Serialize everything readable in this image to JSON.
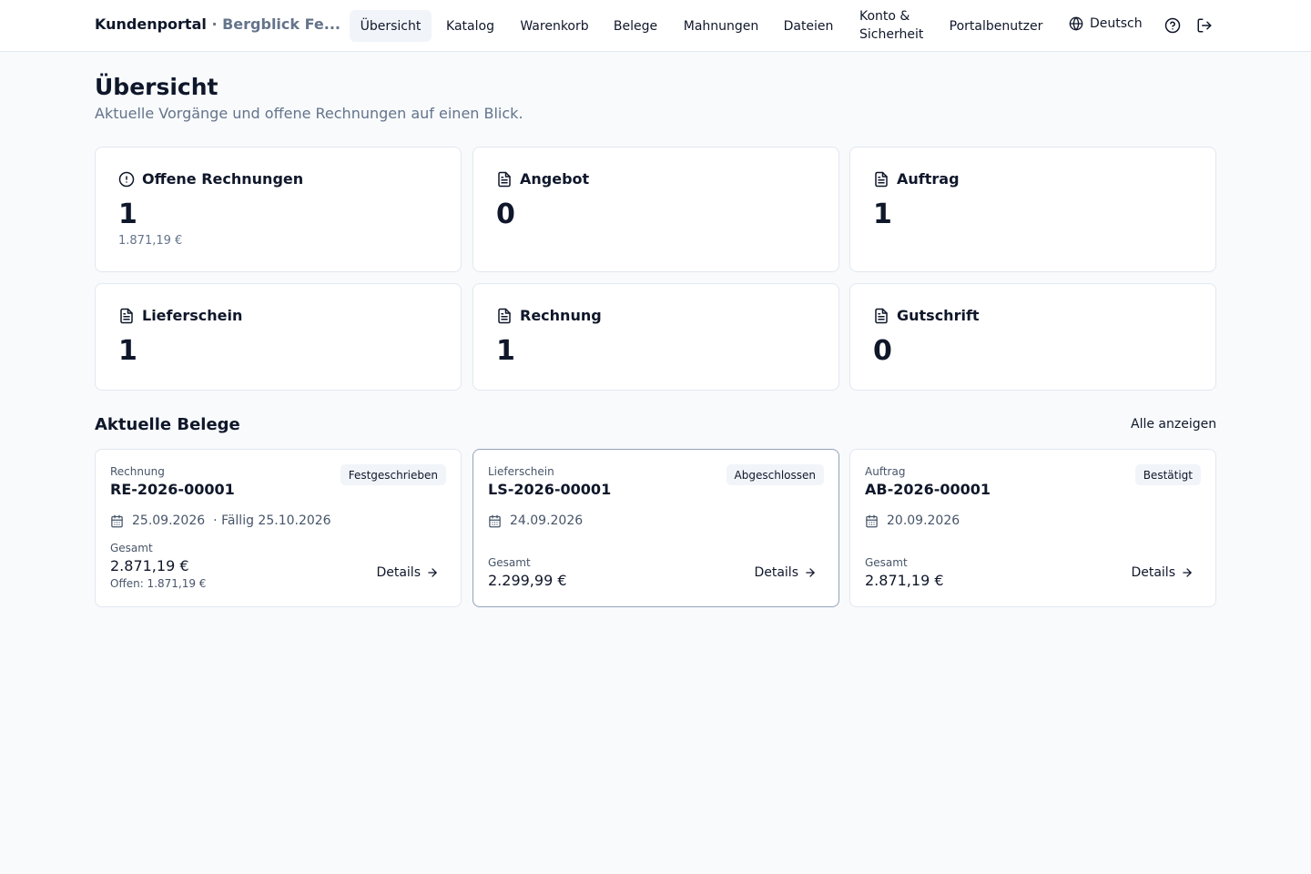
{
  "header": {
    "brand": "Kundenportal",
    "separator": "·",
    "company": "Bergblick Fe...",
    "nav": [
      {
        "label": "Übersicht"
      },
      {
        "label": "Katalog"
      },
      {
        "label": "Warenkorb"
      },
      {
        "label": "Belege"
      },
      {
        "label": "Mahnungen"
      },
      {
        "label": "Dateien"
      },
      {
        "label": "Konto & Sicherheit"
      },
      {
        "label": "Portalbenutzer"
      }
    ],
    "language": "Deutsch"
  },
  "page": {
    "title": "Übersicht",
    "subtitle": "Aktuelle Vorgänge und offene Rechnungen auf einen Blick."
  },
  "stats": [
    {
      "label": "Offene Rechnungen",
      "value": "1",
      "sub": "1.871,19 €",
      "icon": "alert-circle-icon"
    },
    {
      "label": "Angebot",
      "value": "0",
      "icon": "document-icon"
    },
    {
      "label": "Auftrag",
      "value": "1",
      "icon": "document-icon"
    },
    {
      "label": "Lieferschein",
      "value": "1",
      "icon": "document-icon"
    },
    {
      "label": "Rechnung",
      "value": "1",
      "icon": "document-icon"
    },
    {
      "label": "Gutschrift",
      "value": "0",
      "icon": "document-icon"
    }
  ],
  "recent": {
    "title": "Aktuelle Belege",
    "show_all": "Alle anzeigen",
    "docs": [
      {
        "type": "Rechnung",
        "number": "RE-2026-00001",
        "status": "Festgeschrieben",
        "date": "25.09.2026",
        "due": "· Fällig 25.10.2026",
        "total_label": "Gesamt",
        "total": "2.871,19 €",
        "open": "Offen: 1.871,19 €",
        "details": "Details"
      },
      {
        "type": "Lieferschein",
        "number": "LS-2026-00001",
        "status": "Abgeschlossen",
        "date": "24.09.2026",
        "total_label": "Gesamt",
        "total": "2.299,99 €",
        "details": "Details"
      },
      {
        "type": "Auftrag",
        "number": "AB-2026-00001",
        "status": "Bestätigt",
        "date": "20.09.2026",
        "total_label": "Gesamt",
        "total": "2.871,19 €",
        "details": "Details"
      }
    ]
  }
}
